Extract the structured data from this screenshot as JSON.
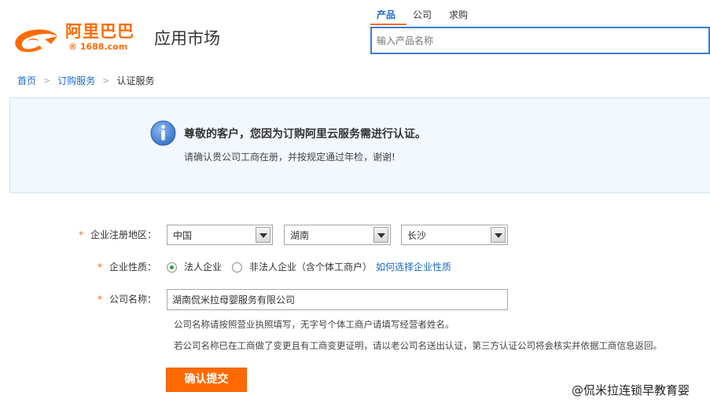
{
  "header": {
    "logo_text": "阿里巴巴",
    "logo_subtext": "® 1688.com",
    "app_title": "应用市场",
    "search": {
      "tabs": [
        {
          "label": "产品",
          "active": true
        },
        {
          "label": "公司",
          "active": false
        },
        {
          "label": "求购",
          "active": false
        }
      ],
      "placeholder": "输入产品名称"
    }
  },
  "breadcrumb": {
    "items": [
      "首页",
      "订购服务",
      "认证服务"
    ]
  },
  "notice": {
    "icon": "info-icon",
    "title": "尊敬的客户，您因为订购阿里云服务需进行认证。",
    "subtitle": "请确认贵公司工商在册，并按规定通过年检，谢谢!"
  },
  "form": {
    "region": {
      "required_mark": "*",
      "label": "企业注册地区：",
      "country": "中国",
      "province": "湖南",
      "city": "长沙"
    },
    "nature": {
      "required_mark": "*",
      "label": "企业性质：",
      "options": [
        {
          "label": "法人企业",
          "checked": true
        },
        {
          "label": "非法人企业（含个体工商户）",
          "checked": false
        }
      ],
      "help_link": "如何选择企业性质"
    },
    "company": {
      "required_mark": "*",
      "label": "公司名称：",
      "value": "湖南侃米拉母婴服务有限公司",
      "hint1": "公司名称请按照营业执照填写，无字号个体工商户请填写经营者姓名。",
      "hint2": "若公司名称已在工商做了变更且有工商变更证明，请以老公司名送出认证，第三方认证公司将会核实并依据工商信息返回。"
    },
    "submit_label": "确认提交"
  },
  "watermark": "@侃米拉连锁早教育婴",
  "colors": {
    "accent": "#ff6a00",
    "link": "#1c6ac7",
    "notice_bg": "#f3f7fe"
  }
}
